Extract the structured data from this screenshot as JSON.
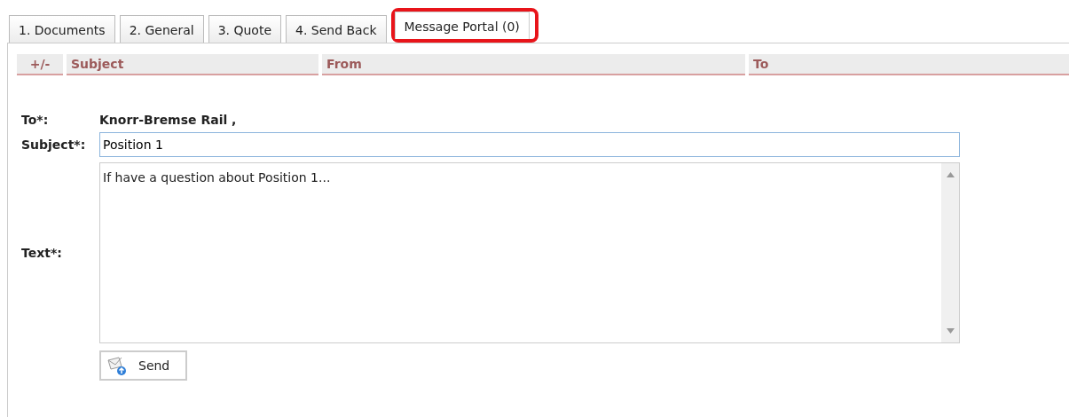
{
  "tabs": [
    {
      "label": "1. Documents",
      "selected": false,
      "highlighted": false
    },
    {
      "label": "2. General",
      "selected": false,
      "highlighted": false
    },
    {
      "label": "3. Quote",
      "selected": false,
      "highlighted": false
    },
    {
      "label": "4. Send Back",
      "selected": false,
      "highlighted": false
    },
    {
      "label": "Message Portal (0)",
      "selected": true,
      "highlighted": true
    }
  ],
  "table": {
    "columns": [
      "+/-",
      "Subject",
      "From",
      "To"
    ]
  },
  "form": {
    "to_label": "To*:",
    "to_value": "Knorr-Bremse Rail ,",
    "subject_label": "Subject*:",
    "subject_value": "Position 1",
    "text_label": "Text*:",
    "text_value": "If have a question about Position 1..."
  },
  "send_button": "Send"
}
